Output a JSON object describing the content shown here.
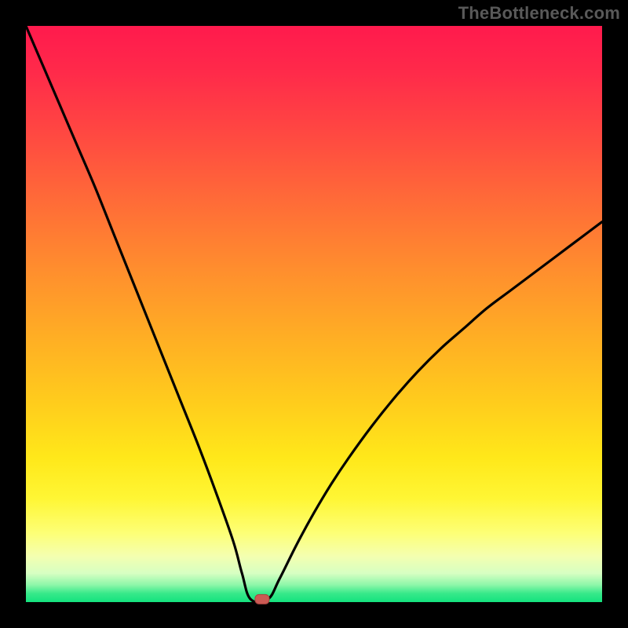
{
  "watermark": "TheBottleneck.com",
  "colors": {
    "frame": "#000000",
    "curve": "#000000",
    "marker_fill": "#cc5a54",
    "marker_stroke": "#a8433e"
  },
  "chart_data": {
    "type": "line",
    "title": "",
    "xlabel": "",
    "ylabel": "",
    "xlim": [
      0,
      100
    ],
    "ylim": [
      0,
      100
    ],
    "grid": false,
    "description": "V-shaped bottleneck curve over vertical red-to-green gradient. Left branch starts at 100% (top-left corner), right branch rises to ~66% at right edge. Minimum at x≈40, y≈0.",
    "series": [
      {
        "name": "left-branch",
        "x": [
          0,
          3,
          6,
          9,
          12,
          15,
          18,
          21,
          24,
          27,
          30,
          33,
          36,
          37.5,
          39
        ],
        "y": [
          100,
          93,
          86,
          79,
          72,
          64.5,
          57,
          49.5,
          42,
          34.5,
          27,
          19,
          10.5,
          5,
          0.5
        ]
      },
      {
        "name": "flat-min",
        "x": [
          39,
          42
        ],
        "y": [
          0.5,
          0.5
        ]
      },
      {
        "name": "right-branch",
        "x": [
          42,
          44,
          47,
          50,
          53,
          56,
          60,
          64,
          68,
          72,
          76,
          80,
          84,
          88,
          92,
          96,
          100
        ],
        "y": [
          0.5,
          4,
          10,
          15.5,
          20.5,
          25,
          30.5,
          35.5,
          40,
          44,
          47.5,
          51,
          54,
          57,
          60,
          63,
          66
        ]
      }
    ],
    "marker": {
      "x": 41,
      "y": 0.5,
      "shape": "rounded-rect"
    }
  }
}
